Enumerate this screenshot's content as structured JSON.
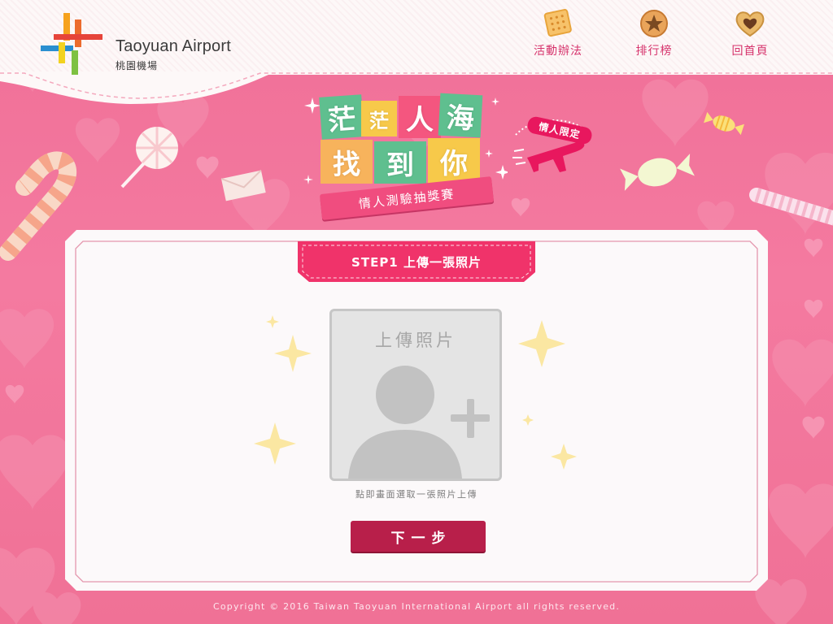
{
  "header": {
    "logo_title": "Taoyuan Airport",
    "logo_subtitle": "桃園機場",
    "nav": [
      {
        "label": "活動辦法",
        "icon": "cracker-icon"
      },
      {
        "label": "排行榜",
        "icon": "star-cookie-icon"
      },
      {
        "label": "回首頁",
        "icon": "heart-cookie-icon"
      }
    ]
  },
  "banner": {
    "title_chars": [
      "茫",
      "茫",
      "人",
      "海",
      "找",
      "到",
      "你"
    ],
    "ribbon_text": "情人測驗抽獎賽",
    "badge_text": "情人限定"
  },
  "step": {
    "label": "STEP1 上傳一張照片"
  },
  "upload": {
    "title": "上傳照片",
    "hint": "點即畫面選取一張照片上傳"
  },
  "actions": {
    "next_label": "下一步"
  },
  "footer": {
    "copyright": "Copyright © 2016 Taiwan Taoyuan International Airport all rights reserved."
  },
  "colors": {
    "background_pink": "#f07a9c",
    "accent_red": "#b81f4a",
    "step_tab": "#f0336a",
    "nav_text": "#d6336c"
  }
}
